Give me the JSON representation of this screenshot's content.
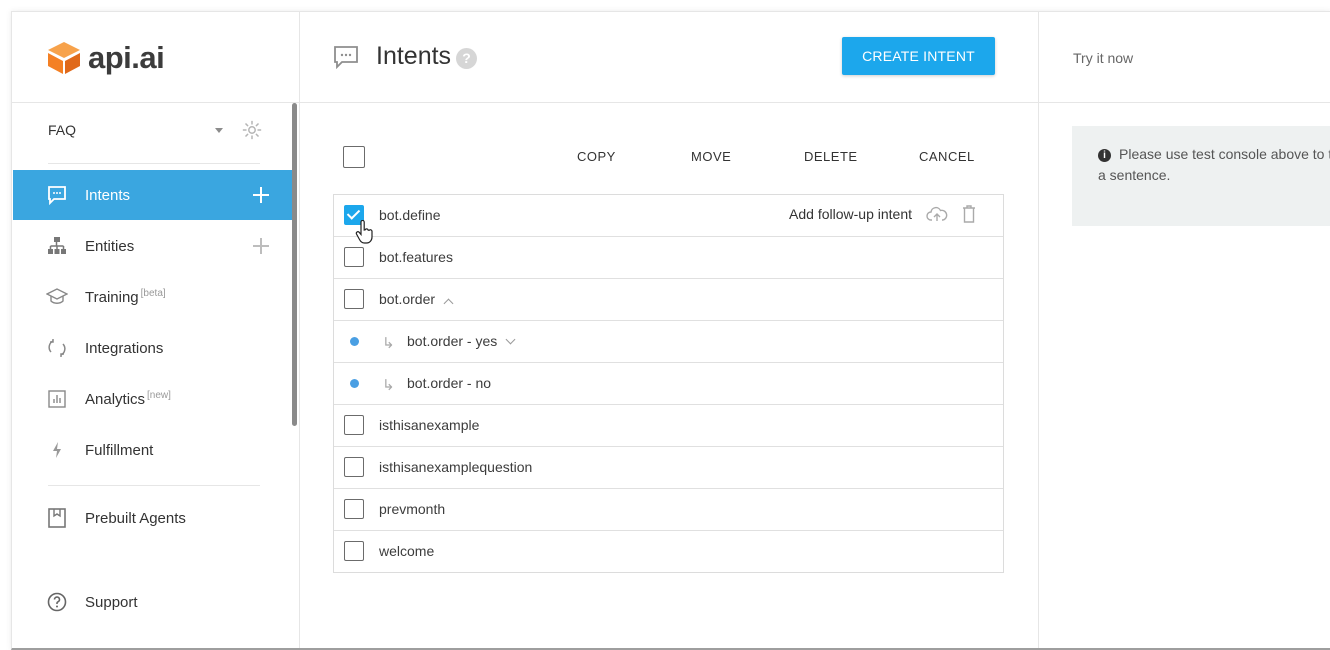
{
  "brand": {
    "name": "api.ai",
    "logo_color": "#f48024"
  },
  "sidebar": {
    "agent_name": "FAQ",
    "items": [
      {
        "label": "Intents",
        "badge": "",
        "icon": "chat-icon",
        "has_add": true,
        "active": true
      },
      {
        "label": "Entities",
        "badge": "",
        "icon": "sitemap-icon",
        "has_add": true,
        "active": false
      },
      {
        "label": "Training",
        "badge": "[beta]",
        "icon": "graduation-cap-icon",
        "has_add": false,
        "active": false
      },
      {
        "label": "Integrations",
        "badge": "",
        "icon": "sync-icon",
        "has_add": false,
        "active": false
      },
      {
        "label": "Analytics",
        "badge": "[new]",
        "icon": "analytics-icon",
        "has_add": false,
        "active": false
      },
      {
        "label": "Fulfillment",
        "badge": "",
        "icon": "bolt-icon",
        "has_add": false,
        "active": false
      },
      {
        "label": "Prebuilt Agents",
        "badge": "",
        "icon": "book-icon",
        "has_add": false,
        "active": false
      },
      {
        "label": "Support",
        "badge": "",
        "icon": "question-icon",
        "has_add": false,
        "active": false
      }
    ]
  },
  "main": {
    "title": "Intents",
    "help_glyph": "?",
    "create_label": "CREATE INTENT",
    "toolbar": {
      "copy": "COPY",
      "move": "MOVE",
      "delete": "DELETE",
      "cancel": "CANCEL"
    },
    "add_followup_label": "Add follow-up intent",
    "intents": [
      {
        "name": "bot.define",
        "checked": true,
        "level": 0
      },
      {
        "name": "bot.features",
        "checked": false,
        "level": 0
      },
      {
        "name": "bot.order",
        "checked": false,
        "level": 0,
        "expanded": true
      },
      {
        "name": "bot.order - yes",
        "checked": false,
        "level": 1,
        "collapsed": true
      },
      {
        "name": "bot.order - no",
        "checked": false,
        "level": 1
      },
      {
        "name": "isthisanexample",
        "checked": false,
        "level": 0
      },
      {
        "name": "isthisanexamplequestion",
        "checked": false,
        "level": 0
      },
      {
        "name": "prevmonth",
        "checked": false,
        "level": 0
      },
      {
        "name": "welcome",
        "checked": false,
        "level": 0
      }
    ]
  },
  "right_panel": {
    "try_it_placeholder": "Try it now",
    "info_glyph": "i",
    "info_message": "Please use test console above to try a sentence."
  },
  "colors": {
    "accent": "#1ca7ec",
    "active_nav": "#3aa6e0",
    "followup_dot": "#4a9fe3"
  }
}
